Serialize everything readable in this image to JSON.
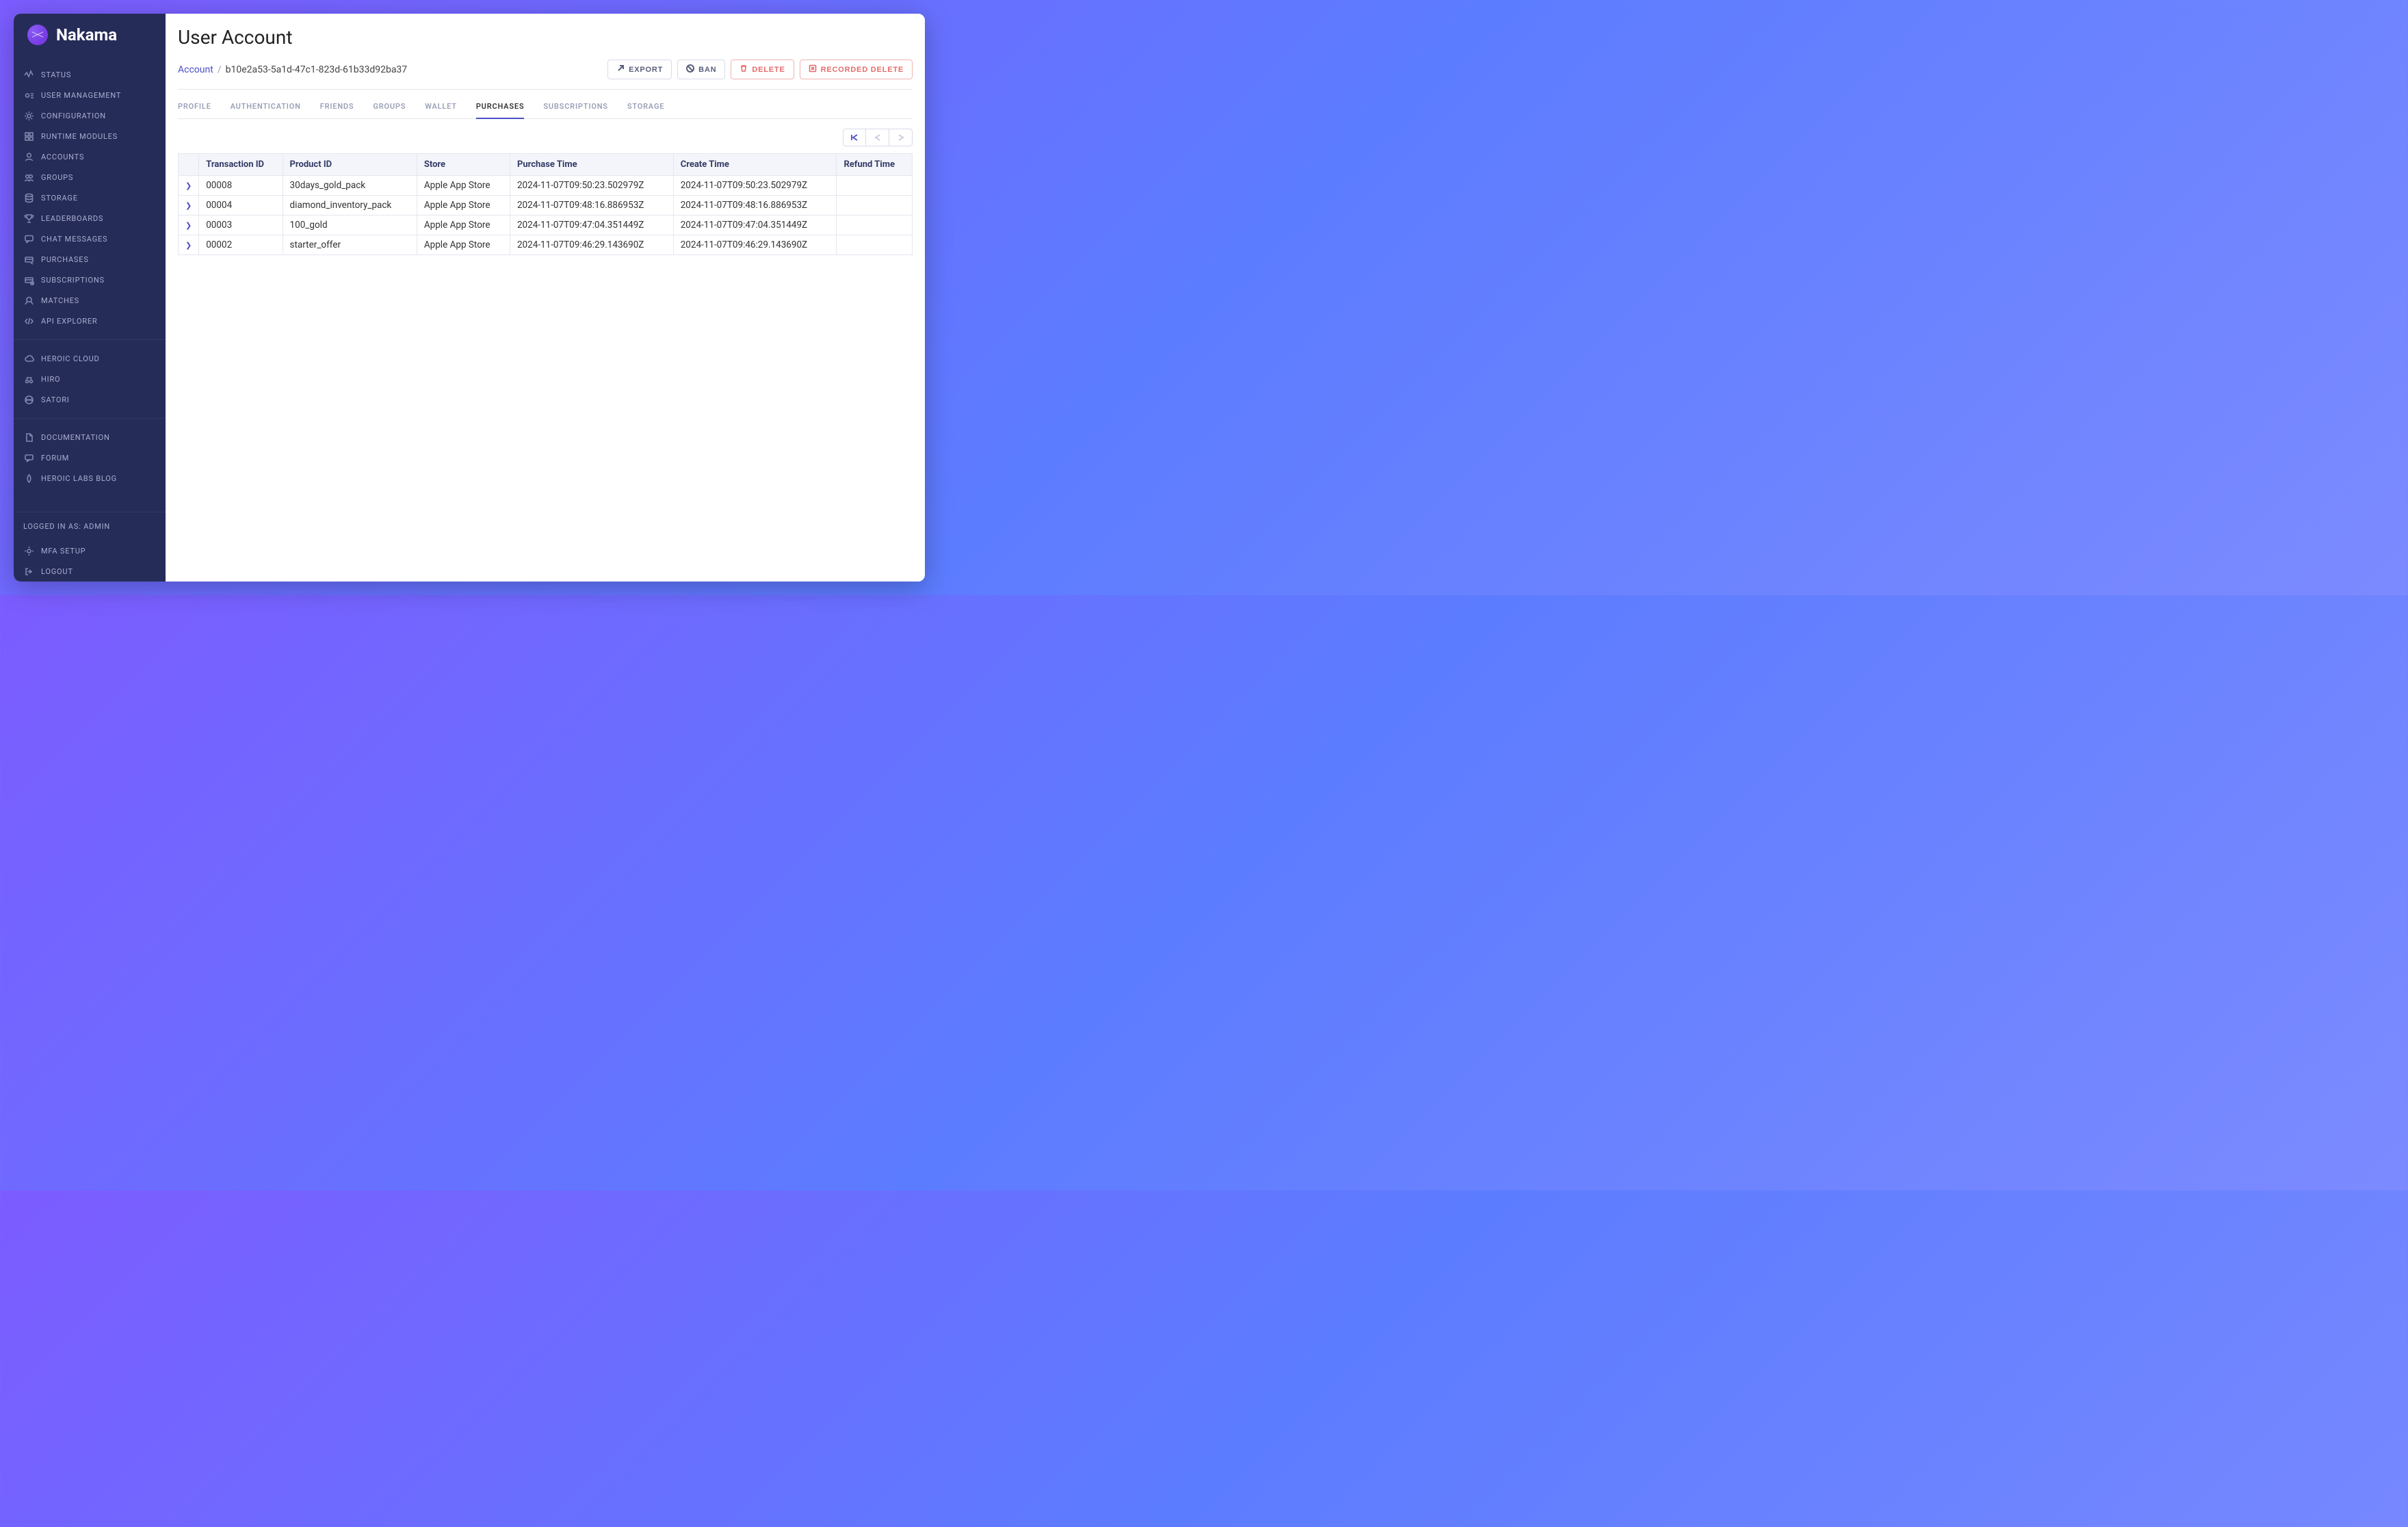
{
  "brand": "Nakama",
  "sidebar": {
    "groups": [
      {
        "items": [
          {
            "id": "status",
            "label": "STATUS"
          },
          {
            "id": "user-management",
            "label": "USER MANAGEMENT"
          },
          {
            "id": "configuration",
            "label": "CONFIGURATION"
          },
          {
            "id": "runtime-modules",
            "label": "RUNTIME MODULES"
          },
          {
            "id": "accounts",
            "label": "ACCOUNTS"
          },
          {
            "id": "groups",
            "label": "GROUPS"
          },
          {
            "id": "storage",
            "label": "STORAGE"
          },
          {
            "id": "leaderboards",
            "label": "LEADERBOARDS"
          },
          {
            "id": "chat-messages",
            "label": "CHAT MESSAGES"
          },
          {
            "id": "purchases",
            "label": "PURCHASES"
          },
          {
            "id": "subscriptions",
            "label": "SUBSCRIPTIONS"
          },
          {
            "id": "matches",
            "label": "MATCHES"
          },
          {
            "id": "api-explorer",
            "label": "API EXPLORER"
          }
        ]
      },
      {
        "items": [
          {
            "id": "heroic-cloud",
            "label": "HEROIC CLOUD"
          },
          {
            "id": "hiro",
            "label": "HIRO"
          },
          {
            "id": "satori",
            "label": "SATORI"
          }
        ]
      },
      {
        "items": [
          {
            "id": "documentation",
            "label": "DOCUMENTATION"
          },
          {
            "id": "forum",
            "label": "FORUM"
          },
          {
            "id": "heroic-labs-blog",
            "label": "HEROIC LABS BLOG"
          }
        ]
      }
    ],
    "footer_login": "LOGGED IN AS: ADMIN",
    "footer_items": [
      {
        "id": "mfa-setup",
        "label": "MFA SETUP"
      },
      {
        "id": "logout",
        "label": "LOGOUT"
      }
    ]
  },
  "page_title": "User Account",
  "breadcrumb": {
    "root": "Account",
    "id": "b10e2a53-5a1d-47c1-823d-61b33d92ba37"
  },
  "actions": {
    "export": "EXPORT",
    "ban": "BAN",
    "delete": "DELETE",
    "recorded_delete": "RECORDED DELETE"
  },
  "tabs": [
    {
      "id": "profile",
      "label": "PROFILE"
    },
    {
      "id": "authentication",
      "label": "AUTHENTICATION"
    },
    {
      "id": "friends",
      "label": "FRIENDS"
    },
    {
      "id": "groups",
      "label": "GROUPS"
    },
    {
      "id": "wallet",
      "label": "WALLET"
    },
    {
      "id": "purchases",
      "label": "PURCHASES",
      "active": true
    },
    {
      "id": "subscriptions",
      "label": "SUBSCRIPTIONS"
    },
    {
      "id": "storage",
      "label": "STORAGE"
    }
  ],
  "table": {
    "headers": [
      "Transaction ID",
      "Product ID",
      "Store",
      "Purchase Time",
      "Create Time",
      "Refund Time"
    ],
    "rows": [
      {
        "txn": "00008",
        "product": "30days_gold_pack",
        "store": "Apple App Store",
        "purchase": "2024-11-07T09:50:23.502979Z",
        "create": "2024-11-07T09:50:23.502979Z",
        "refund": ""
      },
      {
        "txn": "00004",
        "product": "diamond_inventory_pack",
        "store": "Apple App Store",
        "purchase": "2024-11-07T09:48:16.886953Z",
        "create": "2024-11-07T09:48:16.886953Z",
        "refund": ""
      },
      {
        "txn": "00003",
        "product": "100_gold",
        "store": "Apple App Store",
        "purchase": "2024-11-07T09:47:04.351449Z",
        "create": "2024-11-07T09:47:04.351449Z",
        "refund": ""
      },
      {
        "txn": "00002",
        "product": "starter_offer",
        "store": "Apple App Store",
        "purchase": "2024-11-07T09:46:29.143690Z",
        "create": "2024-11-07T09:46:29.143690Z",
        "refund": ""
      }
    ]
  }
}
